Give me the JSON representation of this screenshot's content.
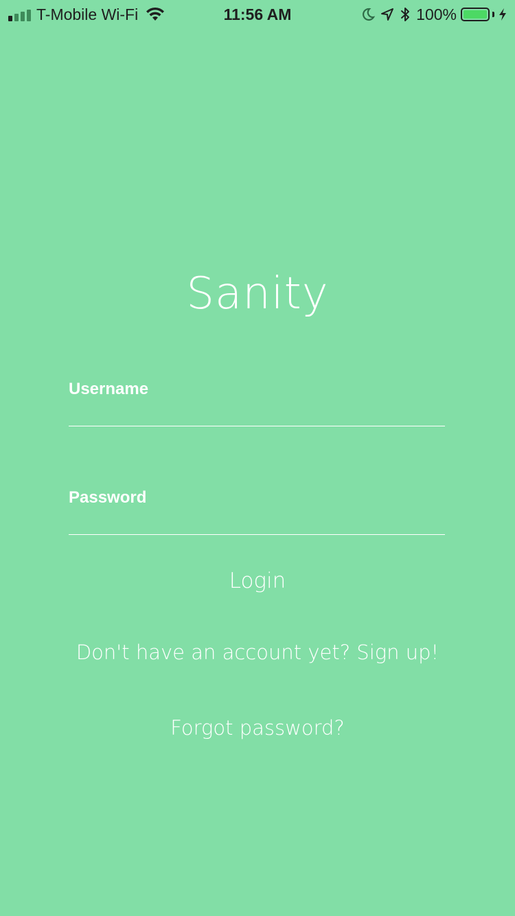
{
  "status_bar": {
    "carrier": "T-Mobile Wi-Fi",
    "time": "11:56 AM",
    "battery_percent": "100%",
    "signal_bars_filled": 1,
    "icons": [
      "signal-icon",
      "wifi-icon",
      "moon-icon",
      "location-arrow-icon",
      "bluetooth-icon",
      "battery-icon",
      "charging-bolt-icon"
    ]
  },
  "app": {
    "title": "Sanity"
  },
  "form": {
    "username_label": "Username",
    "password_label": "Password",
    "username_value": "",
    "password_value": ""
  },
  "actions": {
    "login": "Login",
    "signup": "Don't have an account yet? Sign up!",
    "forgot": "Forgot password?"
  },
  "colors": {
    "background": "#82dea6",
    "text": "#ffffff",
    "battery_fill": "#4cd964",
    "status_text": "#1f1f1f"
  }
}
